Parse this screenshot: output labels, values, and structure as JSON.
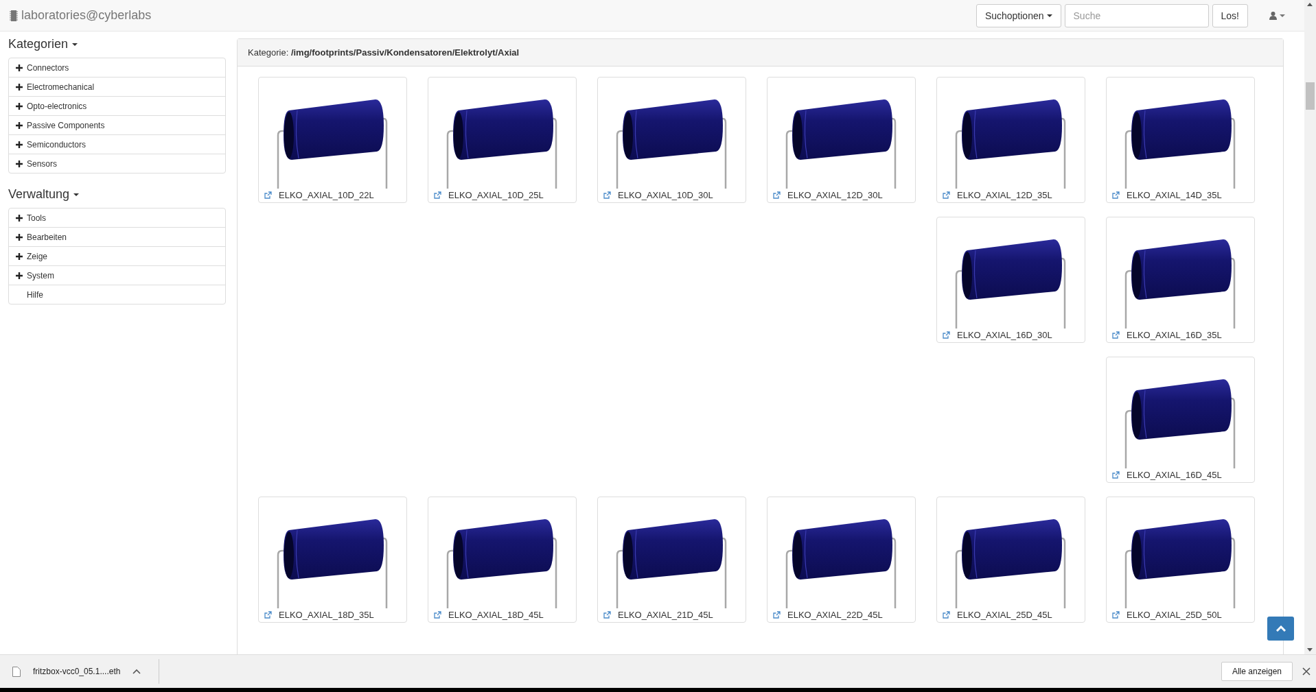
{
  "brand": {
    "text": "laboratories@cyberlabs"
  },
  "search": {
    "options_button": "Suchoptionen",
    "placeholder": "Suche",
    "submit": "Los!"
  },
  "sidebar": {
    "sections": [
      {
        "title": "Kategorien",
        "items": [
          {
            "label": "Connectors",
            "expandable": true
          },
          {
            "label": "Electromechanical",
            "expandable": true
          },
          {
            "label": "Opto-electronics",
            "expandable": true
          },
          {
            "label": "Passive Components",
            "expandable": true
          },
          {
            "label": "Semiconductors",
            "expandable": true
          },
          {
            "label": "Sensors",
            "expandable": true
          }
        ]
      },
      {
        "title": "Verwaltung",
        "items": [
          {
            "label": "Tools",
            "expandable": true
          },
          {
            "label": "Bearbeiten",
            "expandable": true
          },
          {
            "label": "Zeige",
            "expandable": true
          },
          {
            "label": "System",
            "expandable": true
          },
          {
            "label": "Hilfe",
            "expandable": false
          }
        ]
      }
    ]
  },
  "panel": {
    "heading_label": "Kategorie:",
    "heading_path": "/img/footprints/Passiv/Kondensatoren/Elektrolyt/Axial",
    "rows": [
      [
        "ELKO_AXIAL_10D_22L",
        "ELKO_AXIAL_10D_25L",
        "ELKO_AXIAL_10D_30L",
        "ELKO_AXIAL_12D_30L",
        "ELKO_AXIAL_12D_35L",
        "ELKO_AXIAL_14D_35L"
      ],
      [
        "",
        "",
        "",
        "",
        "ELKO_AXIAL_16D_30L",
        "ELKO_AXIAL_16D_35L"
      ],
      [
        "",
        "",
        "",
        "",
        "",
        "ELKO_AXIAL_16D_45L"
      ],
      [
        "ELKO_AXIAL_18D_35L",
        "ELKO_AXIAL_18D_45L",
        "ELKO_AXIAL_21D_45L",
        "ELKO_AXIAL_22D_45L",
        "ELKO_AXIAL_25D_45L",
        "ELKO_AXIAL_25D_50L"
      ]
    ]
  },
  "download_bar": {
    "file": "fritzbox-vcc0_05.1....eth",
    "show_all": "Alle anzeigen"
  }
}
